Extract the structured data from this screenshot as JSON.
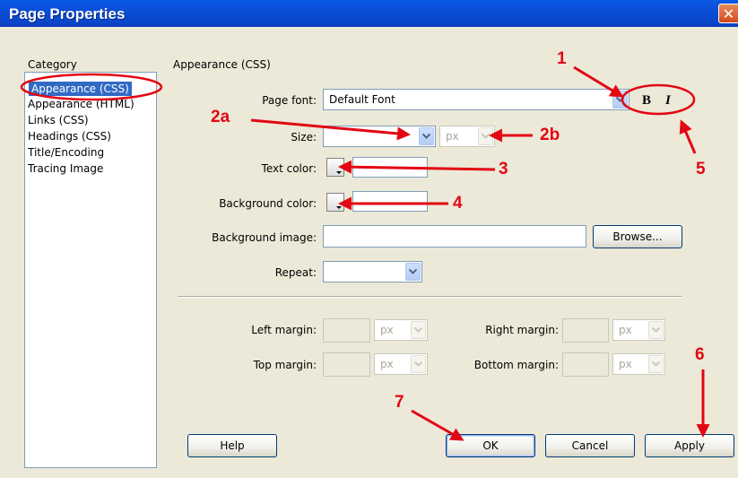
{
  "window": {
    "title": "Page Properties",
    "close_glyph": "✕"
  },
  "category": {
    "header": "Category",
    "items": [
      "Appearance (CSS)",
      "Appearance (HTML)",
      "Links (CSS)",
      "Headings (CSS)",
      "Title/Encoding",
      "Tracing Image"
    ],
    "selected": "Appearance (CSS)"
  },
  "section_title": "Appearance (CSS)",
  "fields": {
    "page_font": {
      "label": "Page font:",
      "value": "Default Font"
    },
    "size": {
      "label": "Size:",
      "value": "",
      "unit": "px"
    },
    "text_color": {
      "label": "Text color:",
      "value": ""
    },
    "background_color": {
      "label": "Background color:",
      "value": ""
    },
    "background_image": {
      "label": "Background image:",
      "value": "",
      "browse_label": "Browse..."
    },
    "repeat": {
      "label": "Repeat:",
      "value": ""
    },
    "left_margin": {
      "label": "Left margin:",
      "value": "",
      "unit": "px"
    },
    "right_margin": {
      "label": "Right margin:",
      "value": "",
      "unit": "px"
    },
    "top_margin": {
      "label": "Top margin:",
      "value": "",
      "unit": "px"
    },
    "bottom_margin": {
      "label": "Bottom margin:",
      "value": "",
      "unit": "px"
    }
  },
  "style_buttons": {
    "bold": "B",
    "italic": "I"
  },
  "buttons": {
    "help": "Help",
    "ok": "OK",
    "cancel": "Cancel",
    "apply": "Apply"
  },
  "annotations": {
    "n1": "1",
    "n2a": "2a",
    "n2b": "2b",
    "n3": "3",
    "n4": "4",
    "n5": "5",
    "n6": "6",
    "n7": "7"
  },
  "colors": {
    "annotation": "#e30613",
    "selection": "#316ac5",
    "titlebar": "#0b4ed6"
  }
}
